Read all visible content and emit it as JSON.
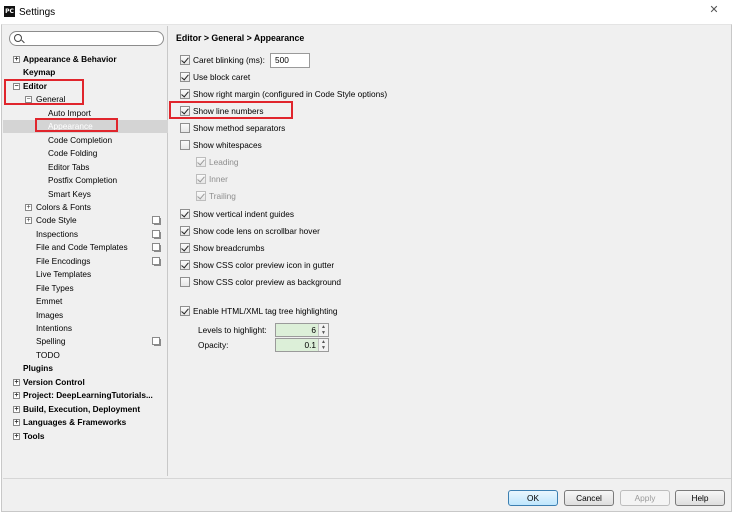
{
  "window": {
    "title": "Settings",
    "app_icon_text": "PC",
    "close_glyph": "✕"
  },
  "search": {
    "placeholder": ""
  },
  "tree": [
    {
      "label": "Appearance & Behavior",
      "bold": true,
      "expander": "+"
    },
    {
      "label": "Keymap",
      "bold": true
    },
    {
      "label": "Editor",
      "bold": true,
      "expander": "−"
    },
    {
      "label": "General",
      "expander": "−"
    },
    {
      "label": "Auto Import"
    },
    {
      "label": "Appearance",
      "selected": true
    },
    {
      "label": "Code Completion"
    },
    {
      "label": "Code Folding"
    },
    {
      "label": "Editor Tabs"
    },
    {
      "label": "Postfix Completion"
    },
    {
      "label": "Smart Keys"
    },
    {
      "label": "Colors & Fonts",
      "expander": "+"
    },
    {
      "label": "Code Style",
      "expander": "+",
      "copy_icon": true
    },
    {
      "label": "Inspections",
      "copy_icon": true
    },
    {
      "label": "File and Code Templates",
      "copy_icon": true
    },
    {
      "label": "File Encodings",
      "copy_icon": true
    },
    {
      "label": "Live Templates"
    },
    {
      "label": "File Types"
    },
    {
      "label": "Emmet"
    },
    {
      "label": "Images"
    },
    {
      "label": "Intentions"
    },
    {
      "label": "Spelling",
      "copy_icon": true
    },
    {
      "label": "TODO"
    },
    {
      "label": "Plugins",
      "bold": true
    },
    {
      "label": "Version Control",
      "bold": true,
      "expander": "+"
    },
    {
      "label": "Project: DeepLearningTutorials...",
      "bold": true,
      "expander": "+"
    },
    {
      "label": "Build, Execution, Deployment",
      "bold": true,
      "expander": "+"
    },
    {
      "label": "Languages & Frameworks",
      "bold": true,
      "expander": "+"
    },
    {
      "label": "Tools",
      "bold": true,
      "expander": "+"
    }
  ],
  "breadcrumb": "Editor > General > Appearance",
  "options": [
    {
      "label": "Caret blinking (ms):",
      "checked": true
    },
    {
      "label": "Use block caret",
      "checked": true
    },
    {
      "label": "Show right margin (configured in Code Style options)",
      "checked": true
    },
    {
      "label": "Show line numbers",
      "checked": true
    },
    {
      "label": "Show method separators",
      "checked": false
    },
    {
      "label": "Show whitespaces",
      "checked": false
    },
    {
      "label": "Leading",
      "checked": true,
      "disabled": true
    },
    {
      "label": "Inner",
      "checked": true,
      "disabled": true
    },
    {
      "label": "Trailing",
      "checked": true,
      "disabled": true
    },
    {
      "label": "Show vertical indent guides",
      "checked": true
    },
    {
      "label": "Show code lens on scrollbar hover",
      "checked": true
    },
    {
      "label": "Show breadcrumbs",
      "checked": true
    },
    {
      "label": "Show CSS color preview icon in gutter",
      "checked": true
    },
    {
      "label": "Show CSS color preview as background",
      "checked": false
    },
    {
      "label": "Enable HTML/XML tag tree highlighting",
      "checked": true
    }
  ],
  "caret_blinking_value": "500",
  "levels_label": "Levels to highlight:",
  "levels_value": "6",
  "opacity_label": "Opacity:",
  "opacity_value": "0.1",
  "buttons": {
    "ok": "OK",
    "cancel": "Cancel",
    "apply": "Apply",
    "help": "Help"
  },
  "colors": {
    "highlight": "#e0252c",
    "selection": "#d4d4d4",
    "spinner_bg": "#dcefd8"
  },
  "icons": {
    "search": "search-icon",
    "expander": "tree-expander-icon",
    "copy": "project-settings-icon",
    "close": "close-icon"
  }
}
